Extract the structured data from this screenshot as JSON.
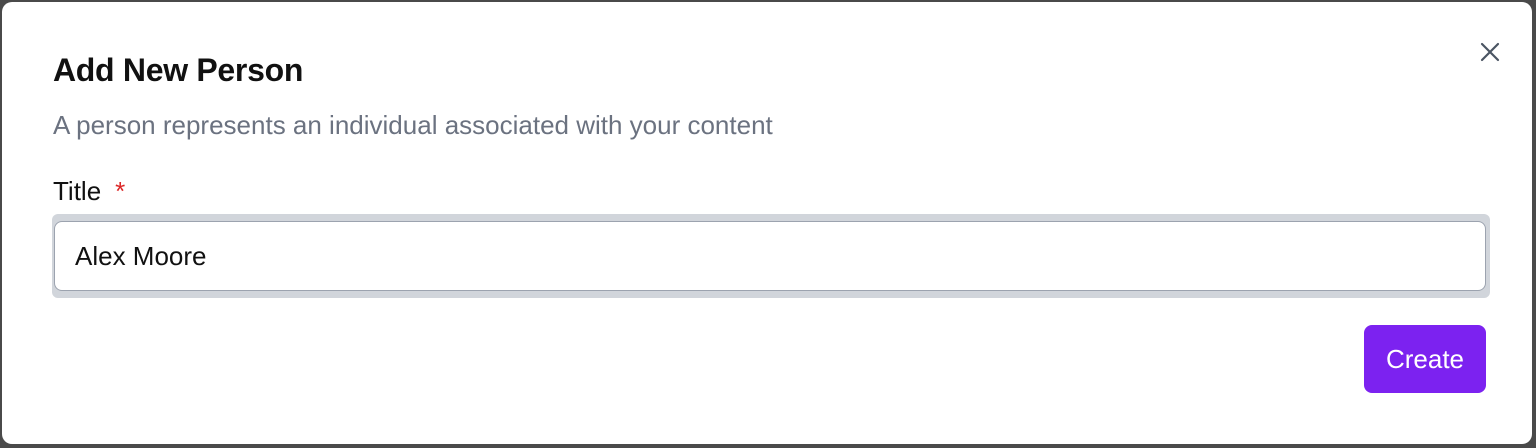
{
  "dialog": {
    "title": "Add New Person",
    "subtitle": "A person represents an individual associated with your content",
    "close_icon": "close-icon"
  },
  "form": {
    "title_field": {
      "label": "Title",
      "required_mark": "*",
      "value": "Alex Moore",
      "placeholder": ""
    }
  },
  "actions": {
    "create_label": "Create"
  },
  "colors": {
    "accent": "#7c22f0",
    "required": "#dc2626",
    "muted_text": "#6b7280"
  }
}
